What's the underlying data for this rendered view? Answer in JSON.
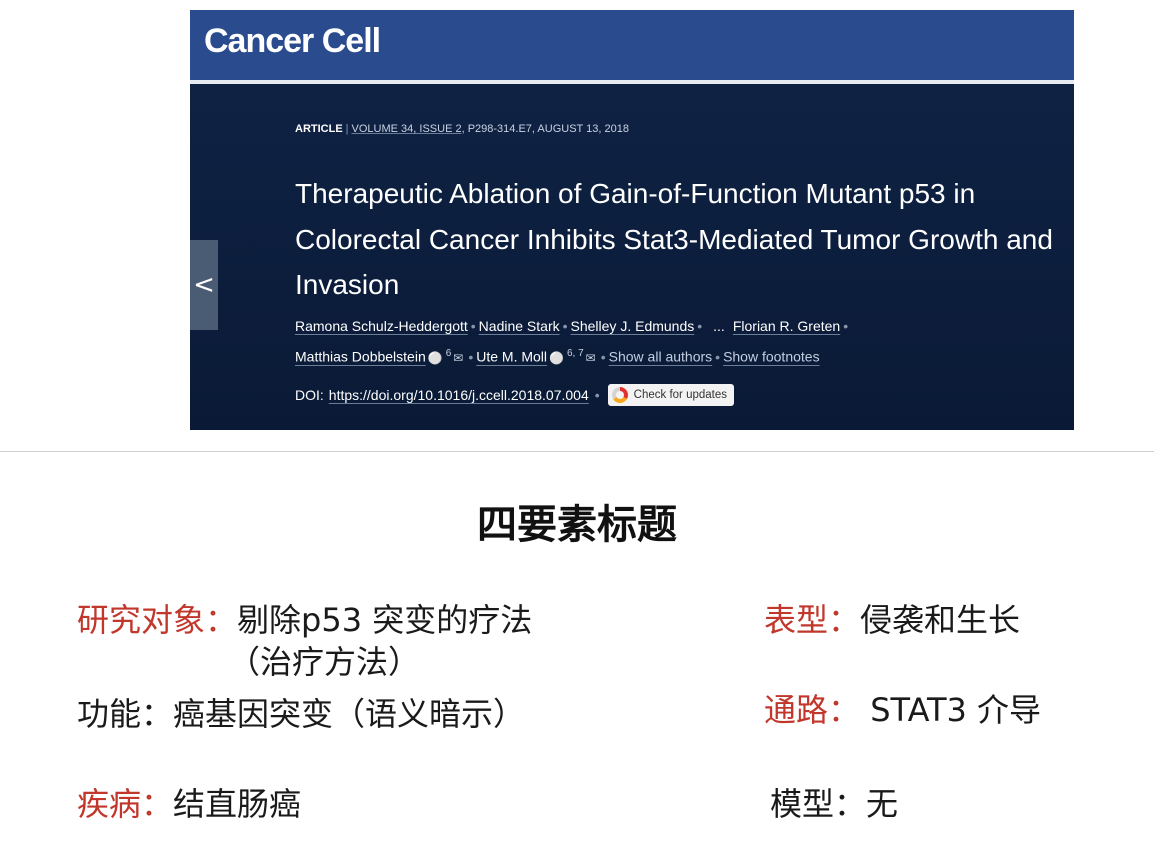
{
  "journal": {
    "name": "Cancer Cell",
    "article_type": "ARTICLE",
    "meta_separator": "|",
    "volume_issue": "VOLUME 34, ISSUE 2",
    "pages_date": "P298-314.E7, AUGUST 13, 2018",
    "title": "Therapeutic Ablation of Gain-of-Function Mutant p53 in Colorectal Cancer Inhibits Stat3-Mediated Tumor Growth and Invasion",
    "authors": {
      "a1": "Ramona Schulz-Heddergott",
      "a2": "Nadine Stark",
      "a3": "Shelley J. Edmunds",
      "ellipsis": "...",
      "a4": "Florian R. Greten",
      "a5": "Matthias Dobbelstein",
      "a5_sup": "6",
      "a6": "Ute M. Moll",
      "a6_sup": "6, 7",
      "show_all": "Show all authors",
      "show_footnotes": "Show footnotes"
    },
    "doi_label": "DOI:",
    "doi": "https://doi.org/10.1016/j.ccell.2018.07.004",
    "check_updates": "Check for updates",
    "prev_arrow": "<"
  },
  "slide": {
    "heading": "四要素标题",
    "items": [
      {
        "label": "研究对象：",
        "label_color": "#c2372b",
        "value": "剔除p53 突变的疗法",
        "value2": "（治疗方法）"
      },
      {
        "label": "表型：",
        "label_color": "#c2372b",
        "value": "侵袭和生长"
      },
      {
        "label": "功能：",
        "label_color": "#1a1a1a",
        "value": "癌基因突变（语义暗示）"
      },
      {
        "label": "通路：",
        "label_color": "#c2372b",
        "value": " STAT3 介导"
      },
      {
        "label": "疾病：",
        "label_color": "#c2372b",
        "value": "结直肠癌"
      },
      {
        "label": "模型：",
        "label_color": "#1a1a1a",
        "value": "无"
      }
    ]
  },
  "colors": {
    "masthead": "#2a4b8d",
    "banner": "#0c1e3c",
    "accent_red": "#c2372b"
  }
}
